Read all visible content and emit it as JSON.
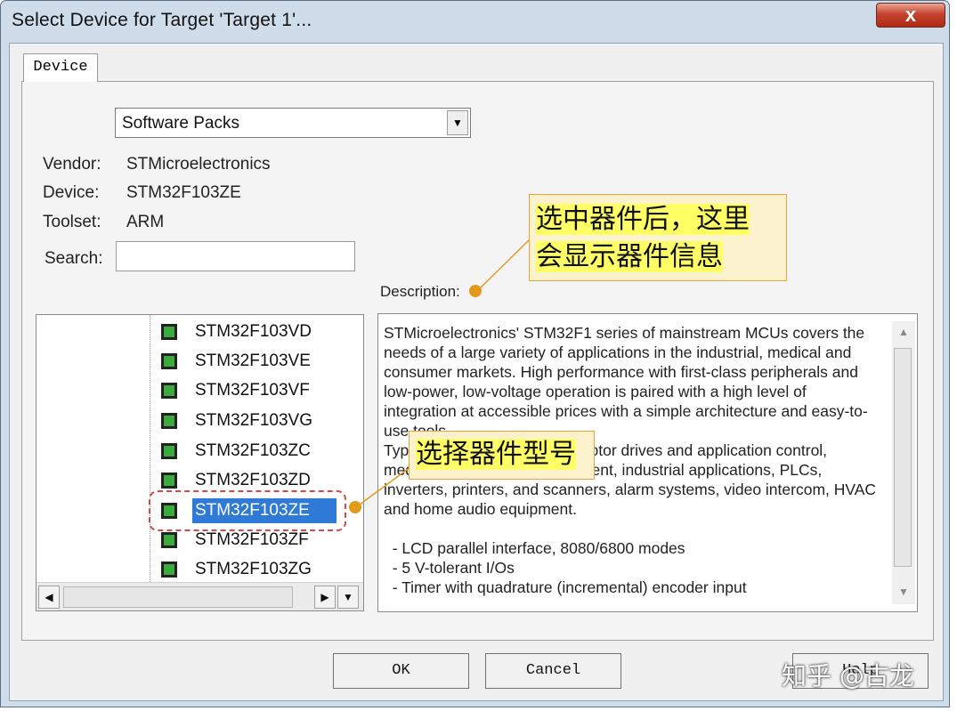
{
  "window": {
    "title": "Select Device for Target 'Target 1'...",
    "close_glyph": "x"
  },
  "tab": {
    "label": "Device"
  },
  "source_combo": {
    "value": "Software Packs",
    "arrow_glyph": "▼"
  },
  "info": {
    "vendor_label": "Vendor:",
    "vendor_value": "STMicroelectronics",
    "device_label": "Device:",
    "device_value": "STM32F103ZE",
    "toolset_label": "Toolset:",
    "toolset_value": "ARM"
  },
  "search": {
    "label": "Search:",
    "value": ""
  },
  "description": {
    "label": "Description:",
    "text": "STMicroelectronics' STM32F1 series of mainstream MCUs covers the needs of a large variety of applications in the industrial, medical and consumer markets. High performance with first-class peripherals and low-power, low-voltage operation is paired with a high level of integration at accessible prices with a simple architecture and easy-to-use tools.\nTypical applications include motor drives and application control, medical and handheld equipment, industrial applications, PLCs, inverters, printers, and scanners, alarm systems, video intercom, HVAC and home audio equipment.\n\n  - LCD parallel interface, 8080/6800 modes\n  - 5 V-tolerant I/Os\n  - Timer with quadrature (incremental) encoder input"
  },
  "device_tree": {
    "items": [
      {
        "label": "STM32F103VD",
        "selected": false
      },
      {
        "label": "STM32F103VE",
        "selected": false
      },
      {
        "label": "STM32F103VF",
        "selected": false
      },
      {
        "label": "STM32F103VG",
        "selected": false
      },
      {
        "label": "STM32F103ZC",
        "selected": false
      },
      {
        "label": "STM32F103ZD",
        "selected": false
      },
      {
        "label": "STM32F103ZE",
        "selected": true
      },
      {
        "label": "STM32F103ZF",
        "selected": false
      },
      {
        "label": "STM32F103ZG",
        "selected": false
      }
    ]
  },
  "scroll_glyphs": {
    "up": "▲",
    "down": "▼",
    "left": "◀",
    "right": "▶"
  },
  "buttons": {
    "ok": "OK",
    "cancel": "Cancel",
    "help": "Help"
  },
  "annotations": {
    "callout_info_line1": "选中器件后，这里",
    "callout_info_line2": "会显示器件信息",
    "callout_select": "选择器件型号"
  },
  "watermark": "知乎 @古龙",
  "colors": {
    "selection": "#2f7ad6",
    "callout_bg": "#fdf2ce",
    "callout_border": "#e8a33d",
    "highlight": "#ffff66",
    "dashed_outline": "#d94848",
    "title_bar": "#cfdcea"
  }
}
